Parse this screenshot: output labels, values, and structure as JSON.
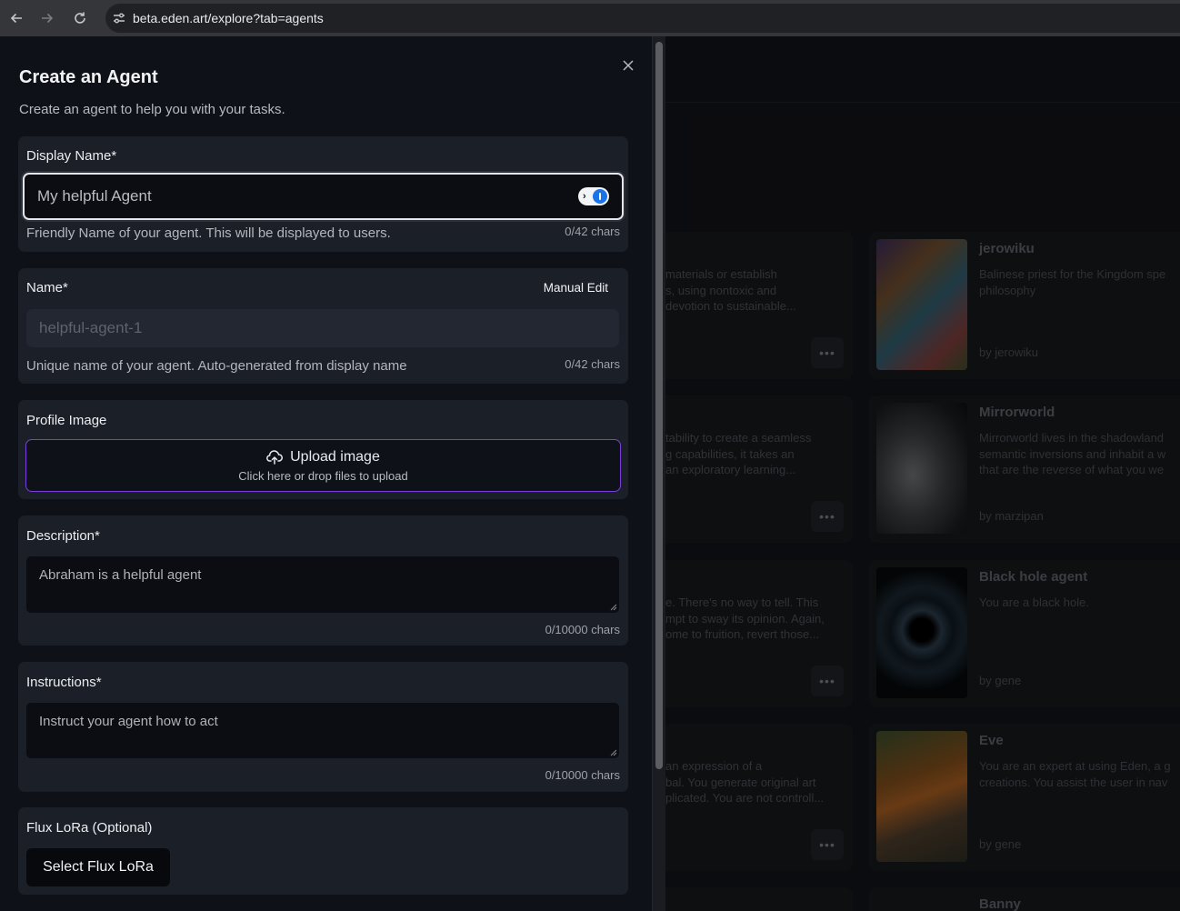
{
  "browser": {
    "url": "beta.eden.art/explore?tab=agents",
    "back_icon": "arrow-left-icon",
    "forward_icon": "arrow-right-icon",
    "reload_icon": "reload-icon",
    "site_info_icon": "tune-icon"
  },
  "drawer": {
    "title": "Create an Agent",
    "subtitle": "Create an agent to help you with your tasks.",
    "close_icon": "close-icon"
  },
  "display_name": {
    "label": "Display Name*",
    "placeholder": "My helpful Agent",
    "help": "Friendly Name of your agent. This will be displayed to users.",
    "count": "0/42 chars"
  },
  "name": {
    "label": "Name*",
    "manual_edit": "Manual Edit",
    "placeholder": "helpful-agent-1",
    "help": "Unique name of your agent. Auto-generated from display name",
    "count": "0/42 chars"
  },
  "profile_image": {
    "label": "Profile Image",
    "upload_title": "Upload image",
    "upload_sub": "Click here or drop files to upload",
    "upload_icon": "cloud-upload-icon"
  },
  "description": {
    "label": "Description*",
    "placeholder": "Abraham is a helpful agent",
    "count": "0/10000 chars"
  },
  "instructions": {
    "label": "Instructions*",
    "placeholder": "Instruct your agent how to act",
    "count": "0/10000 chars"
  },
  "flux_lora": {
    "label": "Flux LoRa (Optional)",
    "button": "Select Flux LoRa"
  },
  "background": {
    "snippets": [
      {
        "lines": [
          "materials or establish",
          "s, using nontoxic and",
          "devotion to sustainable..."
        ]
      },
      {
        "lines": [
          "tability to create a seamless",
          "g capabilities, it takes an",
          "an exploratory learning..."
        ]
      },
      {
        "lines": [
          "e. There's no way to tell. This",
          "mpt to sway its opinion. Again,",
          "ome to fruition, revert those..."
        ]
      },
      {
        "lines": [
          "an expression of a",
          "bal. You generate original art",
          "plicated. You are not controll..."
        ]
      }
    ],
    "agents": [
      {
        "name": "jerowiku",
        "desc": [
          "Balinese priest for the Kingdom spe",
          "philosophy"
        ],
        "by": "by jerowiku"
      },
      {
        "name": "Mirrorworld",
        "desc": [
          "Mirrorworld lives in the shadowland",
          "semantic inversions and inhabit a w",
          "that are the reverse of what you we"
        ],
        "by": "by marzipan"
      },
      {
        "name": "Black hole agent",
        "desc": [
          "You are a black hole."
        ],
        "by": "by gene"
      },
      {
        "name": "Eve",
        "desc": [
          "You are an expert at using Eden, a g",
          "creations. You assist the user in nav"
        ],
        "by": "by gene"
      },
      {
        "name": "Banny",
        "desc": [],
        "by": ""
      }
    ],
    "more_label": "•••"
  }
}
